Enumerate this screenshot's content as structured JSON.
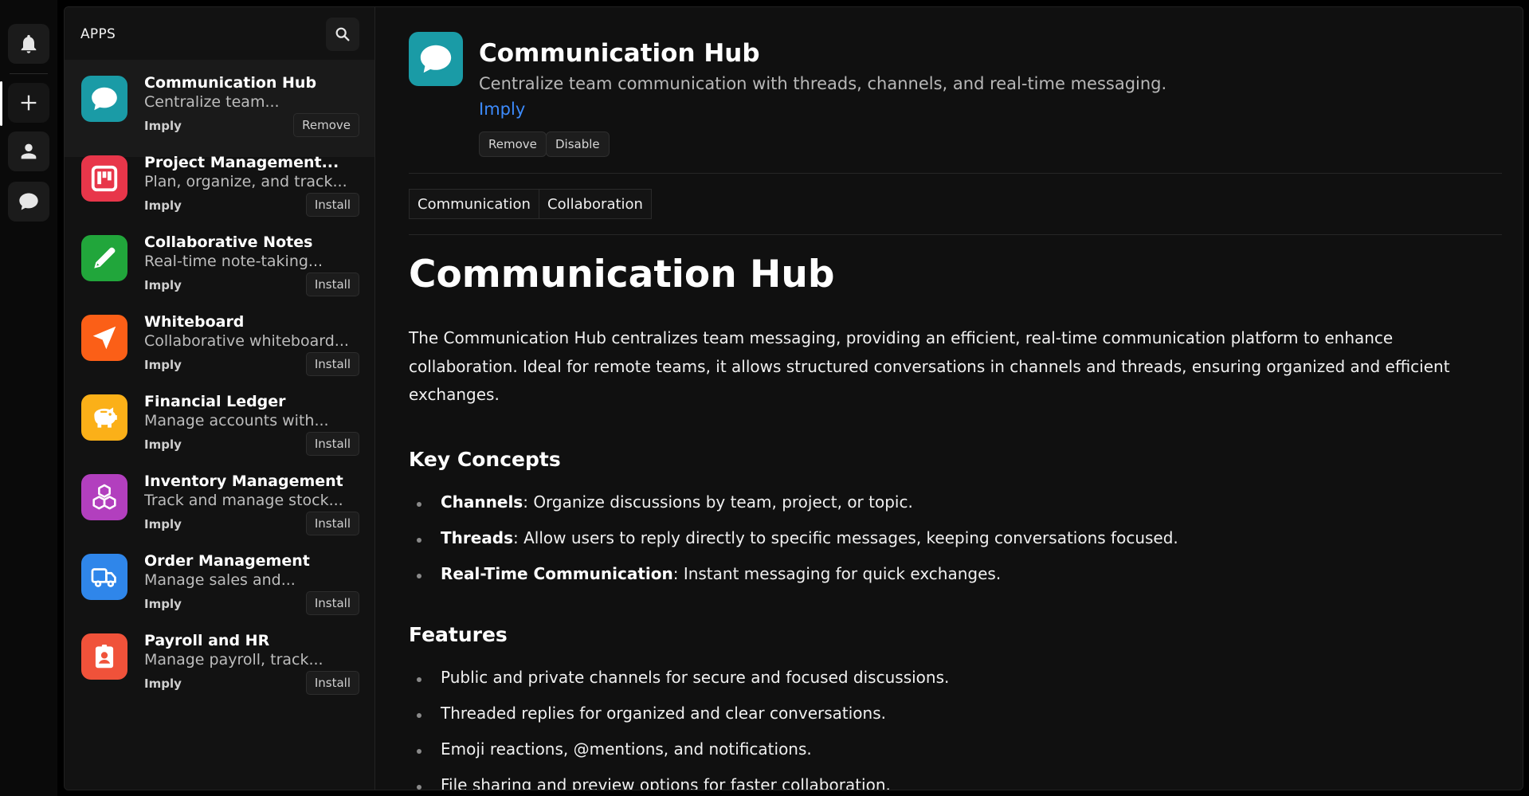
{
  "panel": {
    "title": "APPS",
    "apps": [
      {
        "name": "Communication Hub",
        "description": "Centralize team...",
        "vendor": "Imply",
        "action": "Remove",
        "color": "#1a9ba6",
        "icon": "chat-bubble-icon"
      },
      {
        "name": "Project Management...",
        "description": "Plan, organize, and track...",
        "vendor": "Imply",
        "action": "Install",
        "color": "#e8364a",
        "icon": "kanban-board-icon"
      },
      {
        "name": "Collaborative Notes",
        "description": "Real-time note-taking...",
        "vendor": "Imply",
        "action": "Install",
        "color": "#21a63b",
        "icon": "pen-icon"
      },
      {
        "name": "Whiteboard",
        "description": "Collaborative whiteboard...",
        "vendor": "Imply",
        "action": "Install",
        "color": "#fb5f17",
        "icon": "navigation-arrow-icon"
      },
      {
        "name": "Financial Ledger",
        "description": "Manage accounts with...",
        "vendor": "Imply",
        "action": "Install",
        "color": "#fbb018",
        "icon": "piggy-bank-icon"
      },
      {
        "name": "Inventory Management",
        "description": "Track and manage stock...",
        "vendor": "Imply",
        "action": "Install",
        "color": "#b23fbe",
        "icon": "boxes-icon"
      },
      {
        "name": "Order Management",
        "description": "Manage sales and...",
        "vendor": "Imply",
        "action": "Install",
        "color": "#2f86ea",
        "icon": "truck-icon"
      },
      {
        "name": "Payroll and HR",
        "description": "Manage payroll, track...",
        "vendor": "Imply",
        "action": "Install",
        "color": "#f0523a",
        "icon": "id-badge-icon"
      }
    ]
  },
  "detail": {
    "title": "Communication Hub",
    "description": "Centralize team communication with threads, channels, and real-time messaging.",
    "vendor": "Imply",
    "remove_label": "Remove",
    "disable_label": "Disable",
    "tags": [
      "Communication",
      "Collaboration"
    ],
    "doc_title": "Communication Hub",
    "intro": "The Communication Hub centralizes team messaging, providing an efficient, real-time communication platform to enhance collaboration. Ideal for remote teams, it allows structured conversations in channels and threads, ensuring organized and efficient exchanges.",
    "key_concepts_heading": "Key Concepts",
    "key_concepts": [
      {
        "term": "Channels",
        "text": ": Organize discussions by team, project, or topic."
      },
      {
        "term": "Threads",
        "text": ": Allow users to reply directly to specific messages, keeping conversations focused."
      },
      {
        "term": "Real-Time Communication",
        "text": ": Instant messaging for quick exchanges."
      }
    ],
    "features_heading": "Features",
    "features": [
      "Public and private channels for secure and focused discussions.",
      "Threaded replies for organized and clear conversations.",
      "Emoji reactions, @mentions, and notifications.",
      "File sharing and preview options for faster collaboration."
    ]
  },
  "colors": {
    "link": "#3d8bfd",
    "background": "#101010"
  }
}
